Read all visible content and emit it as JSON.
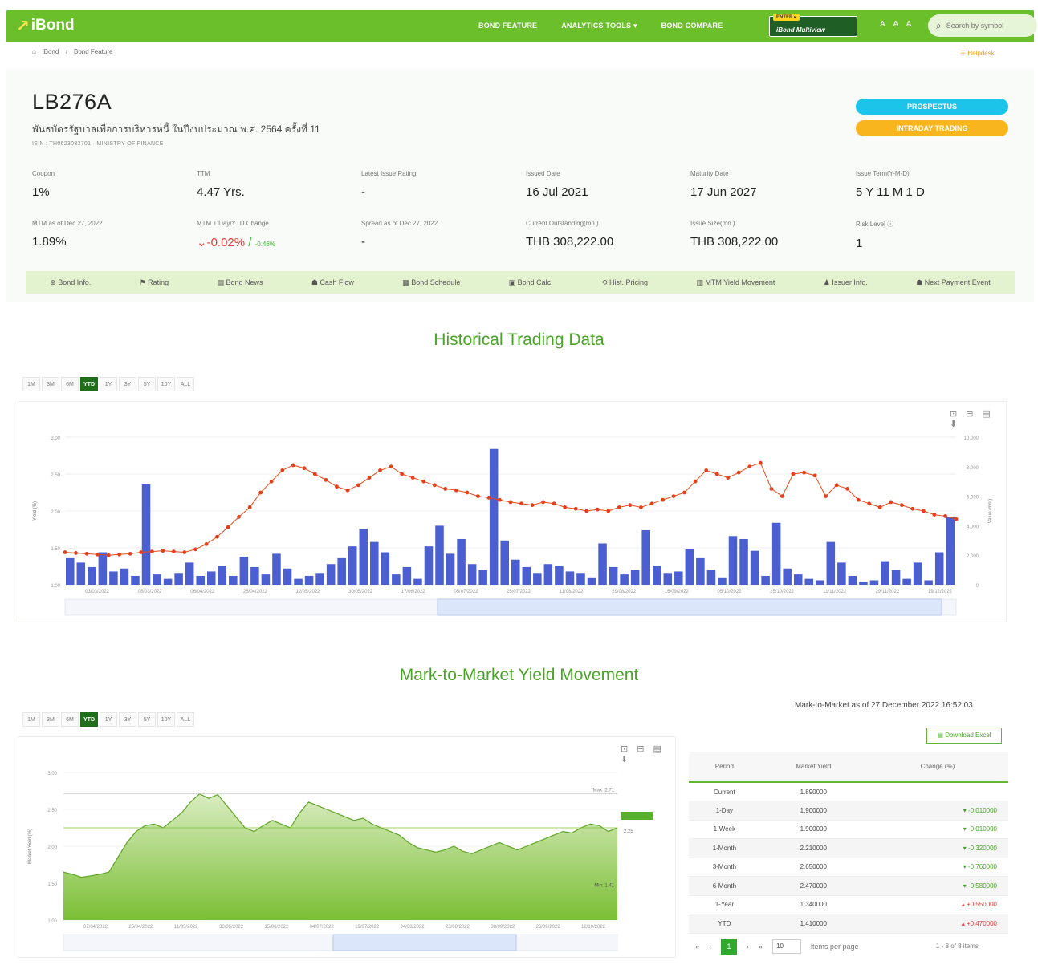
{
  "app": {
    "name": "iBond"
  },
  "nav": {
    "items": [
      "BOND FEATURE",
      "ANALYTICS TOOLS ▾",
      "BOND COMPARE"
    ],
    "badge_tag": "ENTER ▸",
    "badge_text": "iBond Multiview",
    "font_size": "A A A",
    "search_placeholder": "Search by symbol"
  },
  "breadcrumb": {
    "home": "iBond",
    "sep": "›",
    "current": "Bond Feature"
  },
  "help_label": "☰ Helpdesk",
  "bond": {
    "symbol": "LB276A",
    "name_th": "พันธบัตรรัฐบาลเพื่อการบริหารหนี้ ในปีงบประมาณ พ.ศ. 2564 ครั้งที่ 11",
    "sub": "ISIN : TH0623033701 · MINISTRY OF FINANCE",
    "prospectus_label": "PROSPECTUS",
    "intraday_label": "INTRADAY TRADING"
  },
  "info_row1": [
    {
      "label": "Coupon",
      "value": "1%"
    },
    {
      "label": "TTM",
      "value": "4.47 Yrs."
    },
    {
      "label": "Latest Issue Rating",
      "value": "-"
    },
    {
      "label": "Issued Date",
      "value": "16 Jul 2021"
    },
    {
      "label": "Maturity Date",
      "value": "17 Jun 2027"
    },
    {
      "label": "Issue Term(Y-M-D)",
      "value": "5 Y 11 M 1 D"
    }
  ],
  "info_row2": [
    {
      "label": "MTM as of Dec 27, 2022",
      "value": "1.89%"
    },
    {
      "label": "MTM 1 Day/YTD Change",
      "value": "-0.02%",
      "value2": "-0.46%"
    },
    {
      "label": "Spread as of Dec 27, 2022",
      "value": "-"
    },
    {
      "label": "Current Outstanding(mn.)",
      "value": "THB 308,222.00"
    },
    {
      "label": "Issue Size(mn.)",
      "value": "THB 308,222.00"
    },
    {
      "label": "Risk Level ⓘ",
      "value": "1"
    }
  ],
  "tabs": [
    "⊕ Bond Info.",
    "⚑ Rating",
    "▤ Bond News",
    "☗ Cash Flow",
    "▦ Bond Schedule",
    "▣ Bond Calc.",
    "⟲ Hist. Pricing",
    "▥ MTM Yield Movement",
    "♟ Issuer Info.",
    "☗ Next Payment Event"
  ],
  "historical": {
    "title": "Historical Trading Data",
    "ranges": [
      "1M",
      "3M",
      "6M",
      "YTD",
      "1Y",
      "3Y",
      "5Y",
      "10Y",
      "ALL"
    ],
    "active_range": "YTD",
    "tools": "⊡ ⊟ ▤ ⬇"
  },
  "mtm": {
    "title": "Mark-to-Market Yield Movement",
    "ranges": [
      "1M",
      "3M",
      "6M",
      "YTD",
      "1Y",
      "3Y",
      "5Y",
      "10Y",
      "ALL"
    ],
    "active_range": "YTD",
    "tools": "⊡ ⊟ ▤ ⬇",
    "asof": "Mark-to-Market as of 27 December 2022 16:52:03",
    "download_label": "▤ Download Excel",
    "table": {
      "headers": [
        "Period",
        "Market Yield",
        "Change (%)"
      ],
      "rows": [
        {
          "period": "Current",
          "yield": "1.890000",
          "change": "",
          "dir": ""
        },
        {
          "period": "1-Day",
          "yield": "1.900000",
          "change": "▾ -0.010000",
          "dir": "neg"
        },
        {
          "period": "1-Week",
          "yield": "1.900000",
          "change": "▾ -0.010000",
          "dir": "neg"
        },
        {
          "period": "1-Month",
          "yield": "2.210000",
          "change": "▾ -0.320000",
          "dir": "neg"
        },
        {
          "period": "3-Month",
          "yield": "2.650000",
          "change": "▾ -0.760000",
          "dir": "neg"
        },
        {
          "period": "6-Month",
          "yield": "2.470000",
          "change": "▾ -0.580000",
          "dir": "neg"
        },
        {
          "period": "1-Year",
          "yield": "1.340000",
          "change": "▴ +0.550000",
          "dir": "pos"
        },
        {
          "period": "YTD",
          "yield": "1.410000",
          "change": "▴ +0.470000",
          "dir": "pos"
        }
      ]
    },
    "pager": {
      "first": "«",
      "prev": "‹",
      "page": "1",
      "next": "›",
      "last": "»",
      "per_page": "10",
      "per_label": "items per page",
      "count": "1 - 8 of 8 items"
    }
  },
  "chart_data": [
    {
      "type": "line",
      "title": "Historical Trading Data",
      "ylabel": "Yield (%)",
      "y2label": "Value (mn.)",
      "ylim": [
        1.0,
        3.0
      ],
      "y2lim": [
        0,
        10000
      ],
      "y_ticks": [
        "1.00",
        "1.50",
        "2.00",
        "2.50",
        "3.00"
      ],
      "y2_ticks": [
        "0",
        "2,000",
        "4,000",
        "6,000",
        "8,000",
        "10,000"
      ],
      "x_ticks": [
        "03/03/2022",
        "08/03/2022",
        "06/04/2022",
        "25/04/2022",
        "12/05/2022",
        "30/05/2022",
        "17/06/2022",
        "05/07/2022",
        "25/07/2022",
        "11/08/2022",
        "29/08/2022",
        "16/09/2022",
        "05/10/2022",
        "25/10/2022",
        "11/11/2022",
        "29/11/2022",
        "19/12/2022"
      ],
      "series": [
        {
          "name": "Yield",
          "kind": "line",
          "values": [
            1.44,
            1.43,
            1.42,
            1.41,
            1.4,
            1.41,
            1.42,
            1.44,
            1.45,
            1.46,
            1.45,
            1.44,
            1.48,
            1.55,
            1.65,
            1.78,
            1.92,
            2.05,
            2.25,
            2.4,
            2.55,
            2.62,
            2.58,
            2.5,
            2.42,
            2.33,
            2.28,
            2.35,
            2.45,
            2.55,
            2.6,
            2.5,
            2.45,
            2.4,
            2.35,
            2.3,
            2.28,
            2.25,
            2.2,
            2.18,
            2.15,
            2.12,
            2.1,
            2.08,
            2.12,
            2.1,
            2.05,
            2.03,
            2.0,
            2.02,
            2.0,
            2.05,
            2.08,
            2.05,
            2.1,
            2.15,
            2.2,
            2.25,
            2.4,
            2.55,
            2.5,
            2.45,
            2.52,
            2.6,
            2.65,
            2.3,
            2.2,
            2.5,
            2.52,
            2.48,
            2.2,
            2.35,
            2.3,
            2.15,
            2.1,
            2.05,
            2.12,
            2.08,
            2.03,
            2.0,
            1.95,
            1.93,
            1.89
          ]
        },
        {
          "name": "Value",
          "kind": "bar",
          "values": [
            1800,
            1500,
            1200,
            2200,
            900,
            1100,
            600,
            6800,
            700,
            400,
            800,
            1500,
            600,
            900,
            1300,
            600,
            1900,
            1200,
            700,
            2100,
            1100,
            400,
            600,
            800,
            1400,
            1800,
            2600,
            3800,
            2900,
            2200,
            700,
            1200,
            400,
            2600,
            4000,
            2100,
            3100,
            1400,
            1000,
            9200,
            3000,
            1700,
            1200,
            800,
            1400,
            1300,
            900,
            800,
            500,
            2800,
            1200,
            700,
            1000,
            3700,
            1300,
            800,
            900,
            2400,
            1800,
            1000,
            500,
            3300,
            3100,
            2300,
            600,
            4200,
            1100,
            700,
            400,
            300,
            2900,
            1500,
            600,
            200,
            300,
            1600,
            1000,
            400,
            1500,
            300,
            2200,
            4600
          ]
        }
      ]
    },
    {
      "type": "area",
      "title": "Mark-to-Market Yield Movement",
      "ylabel": "Market Yield (%)",
      "ylim": [
        1.0,
        3.0
      ],
      "y_ticks": [
        "1.00",
        "1.50",
        "2.00",
        "2.50",
        "3.00"
      ],
      "x_ticks": [
        "07/04/2022",
        "25/04/2022",
        "11/05/2022",
        "30/05/2022",
        "15/06/2022",
        "04/07/2022",
        "19/07/2022",
        "04/08/2022",
        "23/08/2022",
        "08/09/2022",
        "26/09/2022",
        "12/10/2022"
      ],
      "annotations": [
        "Max: 2.71",
        "Min: 1.41",
        "2.25"
      ],
      "series": [
        {
          "name": "Market Yield",
          "kind": "area",
          "values": [
            1.65,
            1.62,
            1.58,
            1.6,
            1.62,
            1.65,
            1.85,
            2.05,
            2.2,
            2.28,
            2.3,
            2.25,
            2.35,
            2.45,
            2.6,
            2.71,
            2.65,
            2.7,
            2.55,
            2.4,
            2.25,
            2.2,
            2.28,
            2.35,
            2.3,
            2.25,
            2.45,
            2.6,
            2.55,
            2.5,
            2.45,
            2.4,
            2.35,
            2.38,
            2.3,
            2.25,
            2.2,
            2.15,
            2.05,
            1.98,
            1.95,
            1.92,
            1.95,
            2.0,
            1.93,
            1.9,
            1.95,
            2.0,
            2.05,
            2.0,
            1.95,
            2.0,
            2.05,
            2.1,
            2.15,
            2.2,
            2.18,
            2.25,
            2.3,
            2.28,
            2.2,
            2.25
          ]
        }
      ]
    }
  ]
}
